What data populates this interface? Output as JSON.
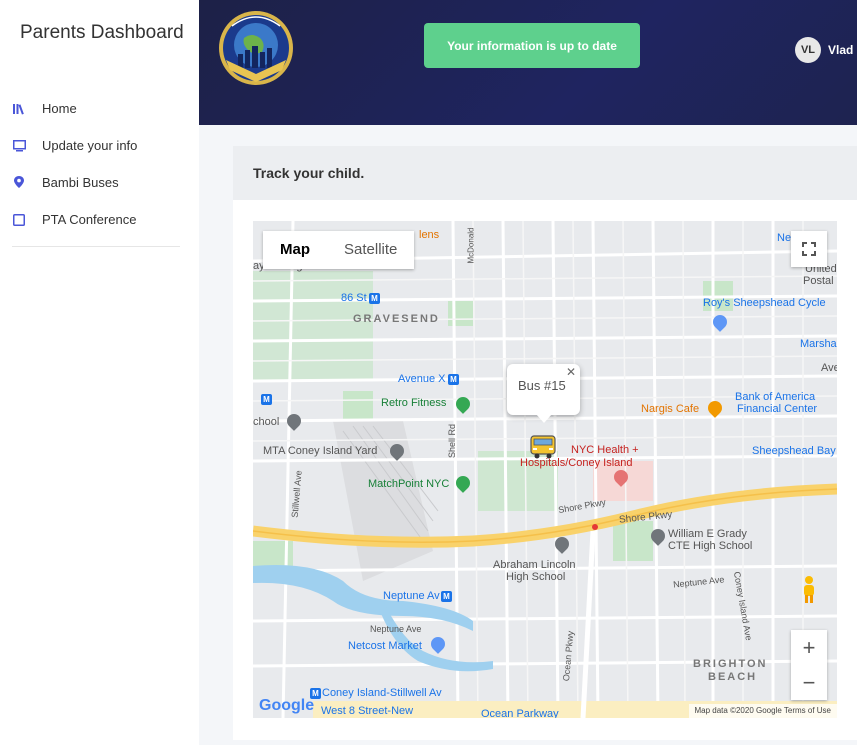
{
  "sidebar": {
    "title": "Parents Dashboard",
    "items": [
      {
        "label": "Home",
        "icon": "library-icon"
      },
      {
        "label": "Update your info",
        "icon": "monitor-icon"
      },
      {
        "label": "Bambi Buses",
        "icon": "location-pin-icon"
      },
      {
        "label": "PTA Conference",
        "icon": "tablet-icon"
      }
    ]
  },
  "header": {
    "toast": "Your information is up to date",
    "user_initials": "VL",
    "user_name": "Vlad"
  },
  "card": {
    "title": "Track your child."
  },
  "map": {
    "types": [
      "Map",
      "Satellite"
    ],
    "active_type": "Map",
    "infowindow": "Bus #15",
    "attribution": "Map data ©2020 Google   Terms of Use",
    "google_logo": "Google",
    "labels": {
      "gravesend": "GRAVESEND",
      "brighton_beach_1": "BRIGHTON",
      "brighton_beach_2": "BEACH",
      "lafayette": "ayette High School",
      "retro_fitness": "Retro Fitness",
      "matchpoint": "MatchPoint NYC",
      "mta_yard": "MTA Coney Island Yard",
      "school": "chool",
      "nyc_health_1": "NYC Health +",
      "nyc_health_2": "Hospitals/Coney Island",
      "nargis": "Nargis Cafe",
      "roys": "Roy's Sheepshead Cycle",
      "boa_1": "Bank of America",
      "boa_2": "Financial Center",
      "sheepshead_bay": "Sheepshead Bay",
      "marsha": "Marsha",
      "united_1": "United",
      "united_2": "Postal",
      "ned": "Ned",
      "grady_1": "William E Grady",
      "grady_2": "CTE High School",
      "lincoln_1": "Abraham Lincoln",
      "lincoln_2": "High School",
      "neptune_av": "Neptune Av",
      "netcost": "Netcost Market",
      "coney_stillwell": "Coney Island-Stillwell Av",
      "west_8": "West 8 Street-New",
      "ocean_parkway": "Ocean Parkway",
      "avenue_x": "Avenue X",
      "st_86": "86 St",
      "shore_pkwy": "Shore Pkwy",
      "shore_pkwy_2": "Shore Pkwy",
      "ocean_pkwy_road": "Ocean Pkwy",
      "shell_rd": "Shell Rd",
      "stillwell_ave": "Stillwell Ave",
      "neptune_ave": "Neptune Ave",
      "neptune_ave_2": "Neptune Ave",
      "coney_island_ave": "Coney Island Ave",
      "lens": "lens",
      "mcdonald": "McDonald",
      "ave_label": "Ave",
      "station_m": "M"
    }
  }
}
